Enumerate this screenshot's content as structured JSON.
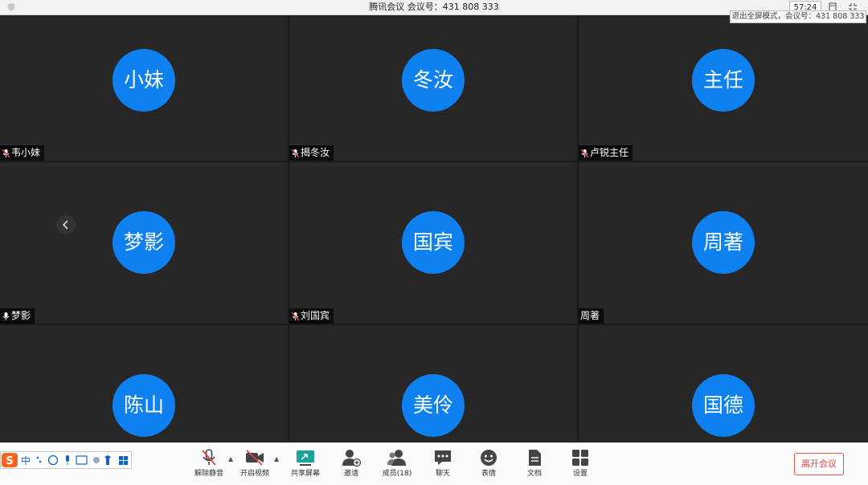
{
  "titlebar": {
    "title": "腾讯会议  会议号：431 808 333",
    "timer": "57:24"
  },
  "tooltip": "退出全屏模式，会议号：431 808 333",
  "participants": [
    {
      "avatar": "小妹",
      "name": "韦小妹",
      "muted": true
    },
    {
      "avatar": "冬汝",
      "name": "揭冬汝",
      "muted": true
    },
    {
      "avatar": "主任",
      "name": "卢锐主任",
      "muted": true
    },
    {
      "avatar": "梦影",
      "name": "梦影",
      "muted": false
    },
    {
      "avatar": "国宾",
      "name": "刘国宾",
      "muted": true
    },
    {
      "avatar": "周著",
      "name": "周著",
      "muted": null
    },
    {
      "avatar": "陈山",
      "name": "",
      "muted": null
    },
    {
      "avatar": "美伶",
      "name": "",
      "muted": null
    },
    {
      "avatar": "国德",
      "name": "",
      "muted": null
    }
  ],
  "toolbar": {
    "unmute": "解除静音",
    "start_video": "开启视频",
    "share_screen": "共享屏幕",
    "invite": "邀请",
    "members": "成员(18)",
    "chat": "聊天",
    "emoji": "表情",
    "docs": "文档",
    "settings": "设置",
    "leave": "离开会议"
  },
  "ime": {
    "logo": "S",
    "mode": "中"
  },
  "colors": {
    "avatar": "#0f80ef",
    "accent": "#1aa39a",
    "danger": "#e04343"
  }
}
